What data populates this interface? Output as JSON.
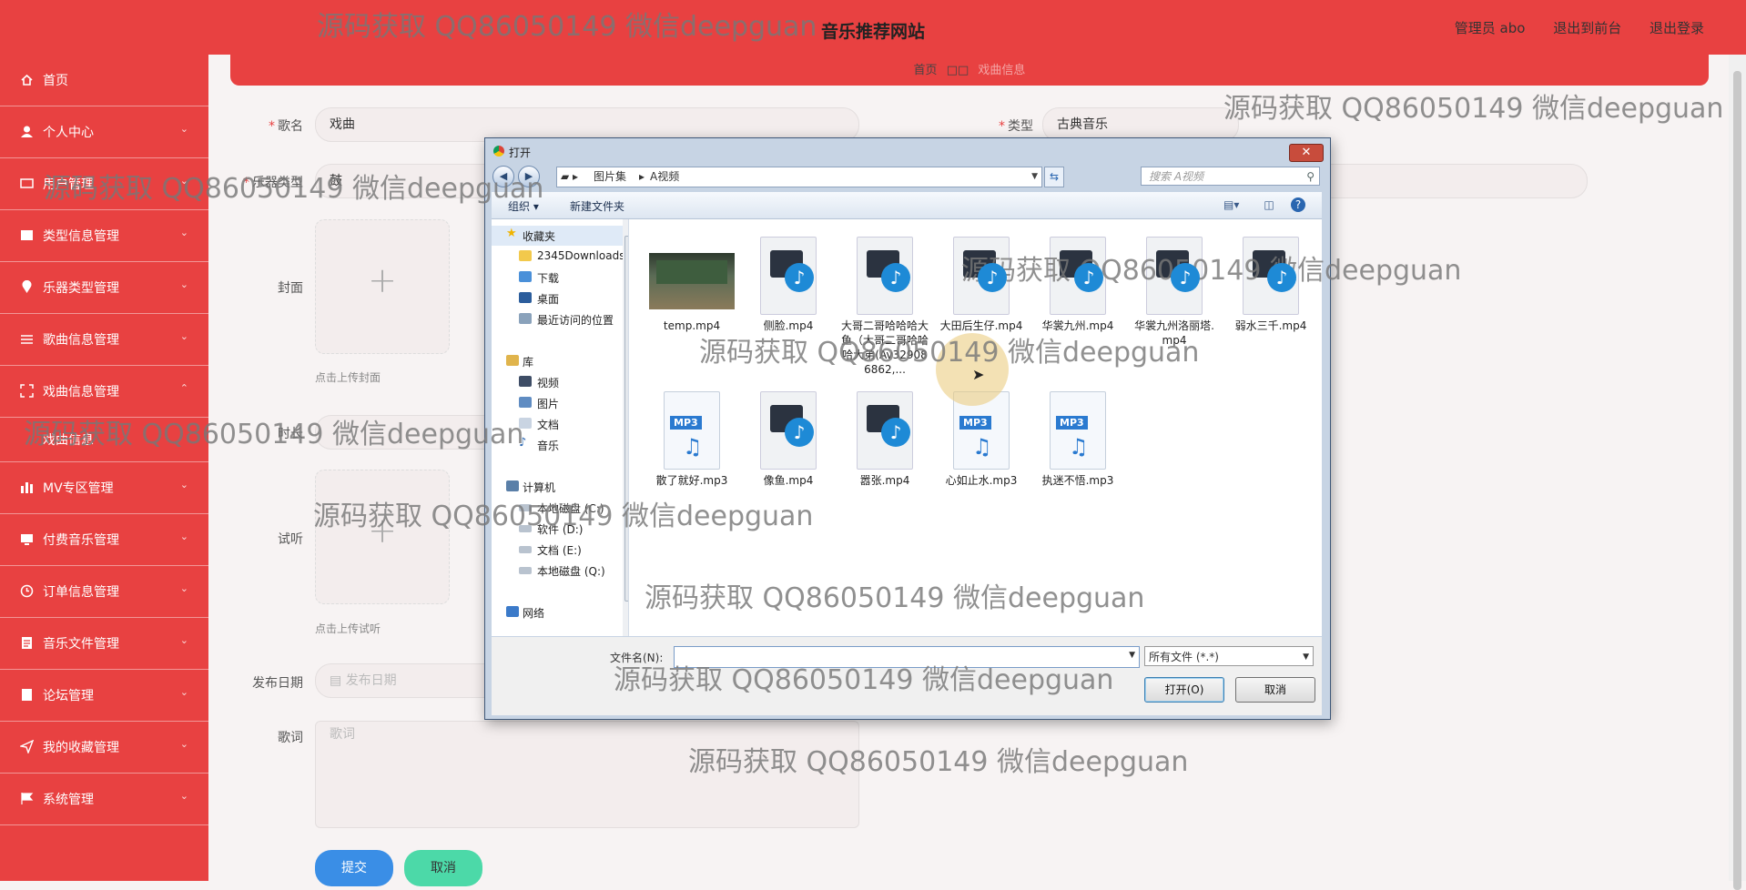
{
  "header": {
    "title": "音乐推荐网站",
    "admin": "管理员 abo",
    "exit_front": "退出到前台",
    "logout": "退出登录"
  },
  "breadcrumb": {
    "home": "首页",
    "sep": "□□",
    "current": "戏曲信息"
  },
  "sidebar": {
    "items": [
      {
        "label": "首页",
        "icon": "home-icon"
      },
      {
        "label": "个人中心",
        "icon": "user-icon"
      },
      {
        "label": "用户管理",
        "icon": "users-icon"
      },
      {
        "label": "类型信息管理",
        "icon": "list-icon"
      },
      {
        "label": "乐器类型管理",
        "icon": "location-icon"
      },
      {
        "label": "歌曲信息管理",
        "icon": "sliders-icon"
      },
      {
        "label": "戏曲信息管理",
        "icon": "expand-icon"
      },
      {
        "label": "戏曲信息",
        "icon": ""
      },
      {
        "label": "MV专区管理",
        "icon": "chart-icon"
      },
      {
        "label": "付费音乐管理",
        "icon": "monitor-icon"
      },
      {
        "label": "订单信息管理",
        "icon": "clock-icon"
      },
      {
        "label": "音乐文件管理",
        "icon": "doc-icon"
      },
      {
        "label": "论坛管理",
        "icon": "forum-icon"
      },
      {
        "label": "我的收藏管理",
        "icon": "send-icon"
      },
      {
        "label": "系统管理",
        "icon": "flag-icon"
      }
    ]
  },
  "form": {
    "song_name_label": "歌名",
    "song_name_value": "戏曲",
    "type_label": "类型",
    "type_value": "古典音乐",
    "instrument_label": "乐器类型",
    "instrument_value": "鼓",
    "cover_label": "封面",
    "cover_hint": "点击上传封面",
    "duration_label": "时长",
    "trial_label": "试听",
    "trial_hint": "点击上传试听",
    "date_label": "发布日期",
    "date_placeholder": "发布日期",
    "lyrics_label": "歌词",
    "lyrics_placeholder": "歌词",
    "submit": "提交",
    "cancel": "取消"
  },
  "dialog": {
    "title": "打开",
    "path": [
      "图片集",
      "A视频"
    ],
    "search_placeholder": "搜索 A视频",
    "organize": "组织 ▾",
    "new_folder": "新建文件夹",
    "nav": [
      {
        "label": "收藏夹",
        "kind": "star"
      },
      {
        "label": "2345Downloads",
        "kind": "folder"
      },
      {
        "label": "下载",
        "kind": "folder"
      },
      {
        "label": "桌面",
        "kind": "desktop"
      },
      {
        "label": "最近访问的位置",
        "kind": "recent"
      },
      {
        "label": "库",
        "kind": "library"
      },
      {
        "label": "视频",
        "kind": "video"
      },
      {
        "label": "图片",
        "kind": "image"
      },
      {
        "label": "文档",
        "kind": "doc"
      },
      {
        "label": "音乐",
        "kind": "music"
      },
      {
        "label": "计算机",
        "kind": "computer"
      },
      {
        "label": "本地磁盘 (C:)",
        "kind": "drive"
      },
      {
        "label": "软件 (D:)",
        "kind": "drive"
      },
      {
        "label": "文档 (E:)",
        "kind": "drive"
      },
      {
        "label": "本地磁盘 (Q:)",
        "kind": "drive"
      },
      {
        "label": "网络",
        "kind": "network"
      }
    ],
    "files": [
      {
        "name": "temp.mp4",
        "kind": "thumb"
      },
      {
        "name": "侧脸.mp4",
        "kind": "video"
      },
      {
        "name": "大哥二哥哈哈哈大鱼（大哥二哥哈哈哈大弟(Av329086862,...",
        "kind": "video"
      },
      {
        "name": "大田后生仔.mp4",
        "kind": "video"
      },
      {
        "name": "华裳九州.mp4",
        "kind": "video"
      },
      {
        "name": "华裳九州洛丽塔.mp4",
        "kind": "video"
      },
      {
        "name": "弱水三千.mp4",
        "kind": "video"
      },
      {
        "name": "散了就好.mp3",
        "kind": "mp3"
      },
      {
        "name": "像鱼.mp4",
        "kind": "video"
      },
      {
        "name": "嚣张.mp4",
        "kind": "video"
      },
      {
        "name": "心如止水.mp3",
        "kind": "mp3"
      },
      {
        "name": "执迷不悟.mp3",
        "kind": "mp3"
      }
    ],
    "filename_label": "文件名(N):",
    "filetype": "所有文件 (*.*)",
    "open": "打开(O)",
    "cancel": "取消"
  },
  "watermark": "源码获取 QQ86050149 微信deepguan"
}
